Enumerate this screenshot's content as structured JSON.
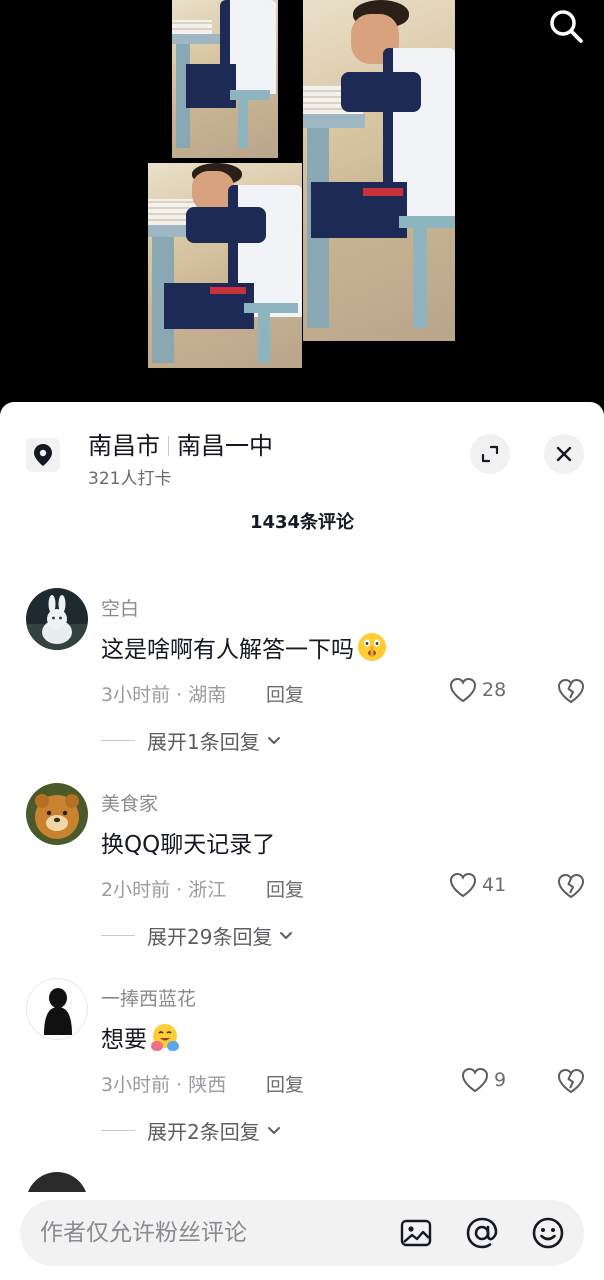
{
  "location": {
    "city": "南昌市",
    "place": "南昌一中",
    "checkins": "321人打卡"
  },
  "comments_header": {
    "count_label": "1434条评论"
  },
  "comments": [
    {
      "username": "空白",
      "text": "这是啥啊有人解答一下吗",
      "emoji": "shush-face-emoji",
      "meta": "3小时前 · 湖南",
      "reply_label": "回复",
      "likes": "28",
      "expand_label": "展开1条回复"
    },
    {
      "username": "美食家",
      "text": "换QQ聊天记录了",
      "meta": "2小时前 · 浙江",
      "reply_label": "回复",
      "likes": "41",
      "expand_label": "展开29条回复"
    },
    {
      "username": "一捧西蓝花",
      "text": "想要",
      "emoji": "hug-emoji",
      "meta": "3小时前 · 陕西",
      "reply_label": "回复",
      "likes": "9",
      "expand_label": "展开2条回复"
    }
  ],
  "input": {
    "placeholder": "作者仅允许粉丝评论"
  },
  "icons": {
    "search": "search-icon",
    "location": "location-pin-icon",
    "expand": "expand-icon",
    "close": "close-icon",
    "like": "heart-icon",
    "dislike": "broken-heart-icon",
    "image": "image-icon",
    "mention": "at-icon",
    "emoji": "smiley-icon"
  },
  "colors": {
    "background": "#000000",
    "sheet": "#ffffff",
    "text_primary": "#161823",
    "text_secondary": "#8a8b91"
  }
}
